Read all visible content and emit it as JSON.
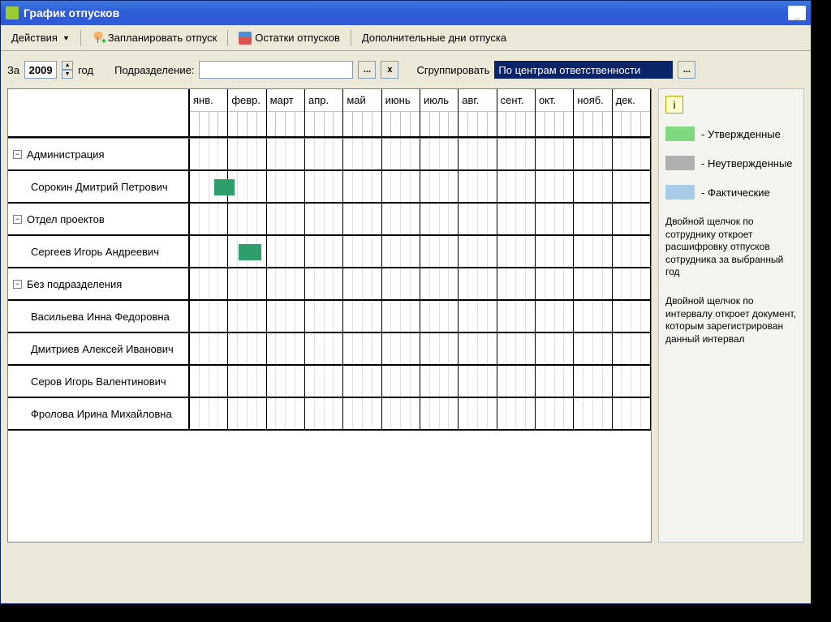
{
  "window": {
    "title": "График отпусков"
  },
  "toolbar": {
    "actions": "Действия",
    "plan": "Запланировать отпуск",
    "remains": "Остатки отпусков",
    "extra": "Дополнительные дни отпуска"
  },
  "filter": {
    "za": "За",
    "year": "2009",
    "god": "год",
    "dept_label": "Подразделение:",
    "ellipsis": "...",
    "x": "x",
    "group_label": "Сгруппировать",
    "group_value": "По центрам ответственности"
  },
  "months": [
    "янв.",
    "февр.",
    "март",
    "апр.",
    "май",
    "июнь",
    "июль",
    "авг.",
    "сент.",
    "окт.",
    "нояб.",
    "дек."
  ],
  "rows": [
    {
      "type": "group",
      "name": "Администрация"
    },
    {
      "type": "child",
      "name": "Сорокин Дмитрий Петрович",
      "bar": {
        "left": 5.2,
        "width": 4.5
      }
    },
    {
      "type": "group",
      "name": "Отдел проектов"
    },
    {
      "type": "child",
      "name": "Сергеев Игорь Андреевич",
      "bar": {
        "left": 10.5,
        "width": 5
      }
    },
    {
      "type": "group",
      "name": "Без подразделения"
    },
    {
      "type": "child",
      "name": "Васильева Инна Федоровна"
    },
    {
      "type": "child",
      "name": "Дмитриев Алексей Иванович"
    },
    {
      "type": "child",
      "name": "Серов Игорь Валентинович"
    },
    {
      "type": "child",
      "name": "Фролова Ирина Михайловна"
    }
  ],
  "legend": {
    "approved": "- Утвержденные",
    "unapproved": "- Неутвержденные",
    "actual": "- Фактические",
    "hint1": "Двойной щелчок по сотруднику откроет расшифровку отпусков сотрудника за выбранный год",
    "hint2": "Двойной щелчок по интервалу откроет документ, которым зарегистрирован данный интервал"
  },
  "expand_symbol": "−",
  "info_symbol": "i"
}
